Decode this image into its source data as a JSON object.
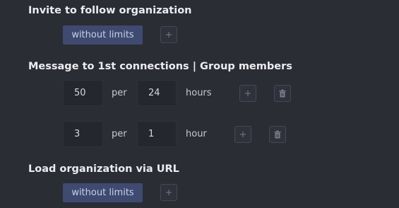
{
  "sections": [
    {
      "title": "Invite to follow organization",
      "limit_label": "without limits"
    },
    {
      "title": "Message to 1st connections | Group members",
      "rules": [
        {
          "count": "50",
          "per_label": "per",
          "period": "24",
          "unit": "hours"
        },
        {
          "count": "3",
          "per_label": "per",
          "period": "1",
          "unit": "hour"
        }
      ]
    },
    {
      "title": "Load organization via URL",
      "limit_label": "without limits"
    }
  ],
  "icons": {
    "add": "plus-icon",
    "delete": "trash-icon"
  },
  "colors": {
    "background": "#2b2d35",
    "pill": "#3e4a70",
    "input": "#25272e"
  }
}
